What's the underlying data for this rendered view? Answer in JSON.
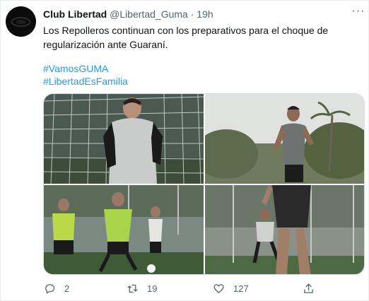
{
  "tweet": {
    "display_name": "Club Libertad",
    "handle": "@Libertad_Guma",
    "separator": "·",
    "time": "19h",
    "text": "Los Repolleros continuan con los preparativos para el choque de regularización ante Guaraní.",
    "hashtags": [
      "#VamosGUMA",
      "#LibertadEsFamilia"
    ]
  },
  "media": {
    "photos": [
      {
        "icon": "photo-player-goal-net"
      },
      {
        "icon": "photo-player-running"
      },
      {
        "icon": "photo-players-ball"
      },
      {
        "icon": "photo-player-legs"
      }
    ]
  },
  "actions": {
    "reply_count": "2",
    "retweet_count": "19",
    "like_count": "127"
  },
  "colors": {
    "accent": "#1d9bf0",
    "muted": "#536471",
    "text": "#0f1419",
    "border": "#e6ecf0"
  }
}
